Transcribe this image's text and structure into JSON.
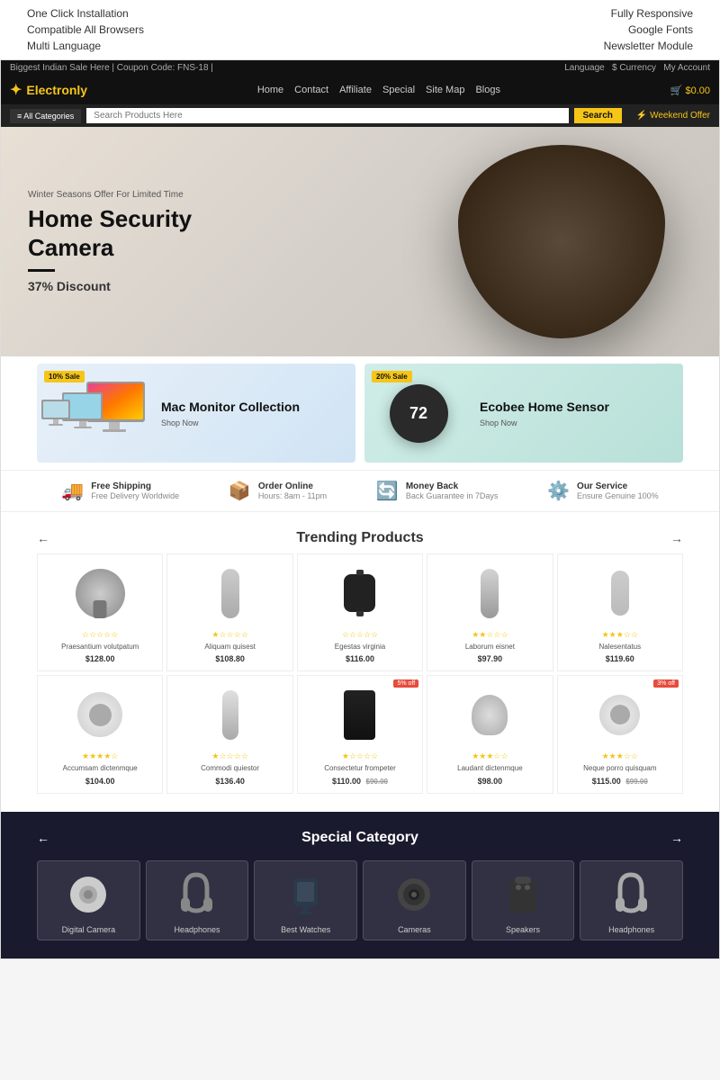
{
  "top_promo": {
    "left_items": [
      "One Click Installation",
      "Compatible All Browsers",
      "Multi Language"
    ],
    "right_items": [
      "Fully Responsive",
      "Google Fonts",
      "Newsletter Module"
    ]
  },
  "store": {
    "topbar": {
      "left": "Biggest Indian Sale Here | Coupon Code: FNS-18 |",
      "lang": "Language",
      "currency": "$ Currency",
      "account": "My Account"
    },
    "logo": "Electronly",
    "nav": {
      "items": [
        "Home",
        "Contact",
        "Affiliate",
        "Special",
        "Site Map",
        "Blogs"
      ],
      "cart": "🛒 $0.00"
    },
    "search": {
      "cat_btn": "≡ All Categories",
      "placeholder": "Search Products Here",
      "btn": "Search"
    },
    "weekend_offer": "⚡ Weekend Offer"
  },
  "hero": {
    "pre_title": "Winter Seasons Offer For Limited Time",
    "title_line1": "Home Security",
    "title_line2": "Camera",
    "discount": "37% Discount"
  },
  "promo_cards": [
    {
      "badge": "10% Sale",
      "title": "Mac Monitor Collection",
      "link": "Shop Now"
    },
    {
      "badge": "20% Sale",
      "title": "Ecobee Home Sensor",
      "link": "Shop Now",
      "display_num": "72"
    }
  ],
  "features": [
    {
      "icon": "🚚",
      "main": "Free Shipping",
      "sub": "Free Delivery Worldwide"
    },
    {
      "icon": "📦",
      "main": "Order Online",
      "sub": "Hours: 8am - 11pm"
    },
    {
      "icon": "🔄",
      "main": "Money Back",
      "sub": "Back Guarantee in 7Days"
    },
    {
      "icon": "⚙️",
      "main": "Our Service",
      "sub": "Ensure Genuine 100%"
    }
  ],
  "trending": {
    "title": "Trending Products",
    "products": [
      {
        "name": "Praesantium volutpatum",
        "price": "$128.00",
        "stars": 0,
        "type": "cam_dome"
      },
      {
        "name": "Aliquam quisest",
        "price": "$108.80",
        "stars": 1,
        "type": "thermos"
      },
      {
        "name": "Egestas virginia",
        "price": "$116.00",
        "stars": 0,
        "type": "smartwatch"
      },
      {
        "name": "Laborum eisnet",
        "price": "$97.90",
        "stars": 2.5,
        "type": "action_cam"
      },
      {
        "name": "Nalesentatus",
        "price": "$119.60",
        "stars": 3,
        "type": "key_cam"
      },
      {
        "name": "Accumsam dictenmque",
        "price": "$104.00",
        "stars": 3.5,
        "type": "speaker_round",
        "badge": ""
      },
      {
        "name": "Commodi quiestor",
        "price": "$136.40",
        "stars": 1,
        "type": "speaker_tall"
      },
      {
        "name": "Consectetur frompeter",
        "price": "$110.00",
        "price_old": "$90.00",
        "stars": 1,
        "type": "bag_speaker",
        "badge": "5% off"
      },
      {
        "name": "Laudant dictenmque",
        "price": "$98.00",
        "stars": 3,
        "type": "cam360"
      },
      {
        "name": "Neque porro quisquam",
        "price": "$115.00",
        "price_old": "$99.00",
        "stars": 2.5,
        "type": "speaker_round2",
        "badge": "3% off"
      }
    ]
  },
  "special_category": {
    "title": "Special Category",
    "items": [
      {
        "label": "Digital Camera",
        "type": "cam_surveillance"
      },
      {
        "label": "Headphones",
        "type": "headphone"
      },
      {
        "label": "Best Watches",
        "type": "smartwatch2"
      },
      {
        "label": "Cameras",
        "type": "lens_cam"
      },
      {
        "label": "Speakers",
        "type": "backpack"
      },
      {
        "label": "Headphones",
        "type": "headphone2"
      }
    ]
  }
}
